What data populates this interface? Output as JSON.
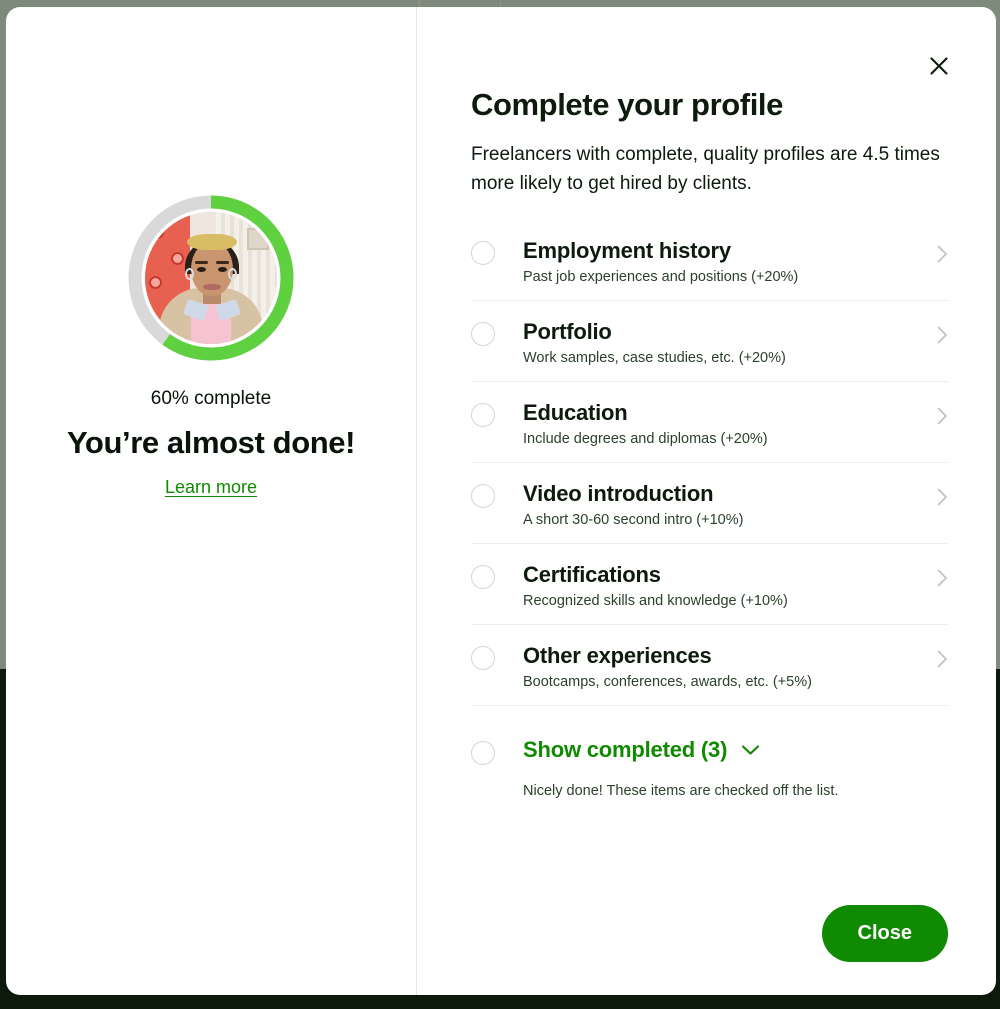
{
  "theme": {
    "brand_green": "#108a00",
    "ring_green": "#5fd140",
    "ring_track": "#d9d9d9",
    "backdrop": "#7e8a7c"
  },
  "left_pane": {
    "avatar_alt": "profile-photo",
    "progress_percent": 60,
    "progress_label": "60% complete",
    "headline": "You’re almost done!",
    "learn_more_label": "Learn more"
  },
  "right_pane": {
    "close_icon": "close-icon",
    "title": "Complete your profile",
    "subtitle": "Freelancers with complete, quality profiles are 4.5 times more likely to get hired by clients.",
    "items": [
      {
        "title": "Employment history",
        "subtitle": "Past job experiences and positions (+20%)",
        "weight": "+20%",
        "completed": false
      },
      {
        "title": "Portfolio",
        "subtitle": "Work samples, case studies, etc. (+20%)",
        "weight": "+20%",
        "completed": false
      },
      {
        "title": "Education",
        "subtitle": "Include degrees and diplomas (+20%)",
        "weight": "+20%",
        "completed": false
      },
      {
        "title": "Video introduction",
        "subtitle": "A short 30-60 second intro (+10%)",
        "weight": "+10%",
        "completed": false
      },
      {
        "title": "Certifications",
        "subtitle": "Recognized skills and knowledge (+10%)",
        "weight": "+10%",
        "completed": false
      },
      {
        "title": "Other experiences",
        "subtitle": "Bootcamps, conferences, awards, etc. (+5%)",
        "weight": "+5%",
        "completed": false
      }
    ],
    "completed_section": {
      "label": "Show completed (3)",
      "count": 3,
      "chevron_icon": "chevron-down-icon",
      "note": "Nicely done! These items are checked off the list."
    },
    "footer": {
      "close_label": "Close"
    }
  }
}
